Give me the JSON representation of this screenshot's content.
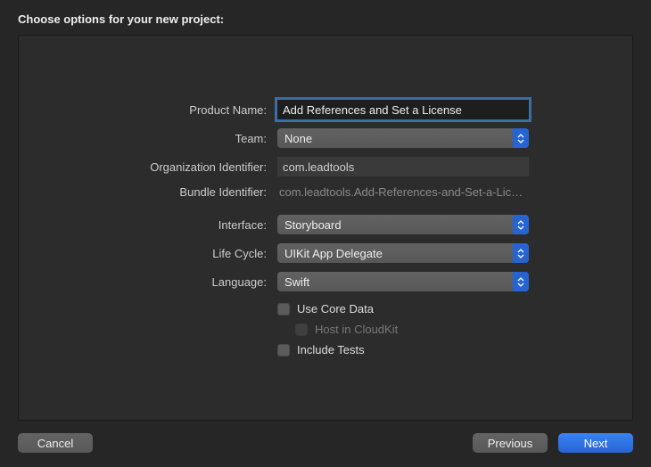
{
  "title": "Choose options for your new project:",
  "labels": {
    "product_name": "Product Name:",
    "team": "Team:",
    "org_identifier": "Organization Identifier:",
    "bundle_identifier": "Bundle Identifier:",
    "interface": "Interface:",
    "life_cycle": "Life Cycle:",
    "language": "Language:"
  },
  "values": {
    "product_name": "Add References and Set a License",
    "team": "None",
    "org_identifier": "com.leadtools",
    "bundle_identifier": "com.leadtools.Add-References-and-Set-a-Lice…",
    "interface": "Storyboard",
    "life_cycle": "UIKit App Delegate",
    "language": "Swift"
  },
  "checkboxes": {
    "use_core_data": {
      "label": "Use Core Data",
      "checked": false,
      "enabled": true
    },
    "host_in_cloudkit": {
      "label": "Host in CloudKit",
      "checked": false,
      "enabled": false
    },
    "include_tests": {
      "label": "Include Tests",
      "checked": false,
      "enabled": true
    }
  },
  "buttons": {
    "cancel": "Cancel",
    "previous": "Previous",
    "next": "Next"
  }
}
